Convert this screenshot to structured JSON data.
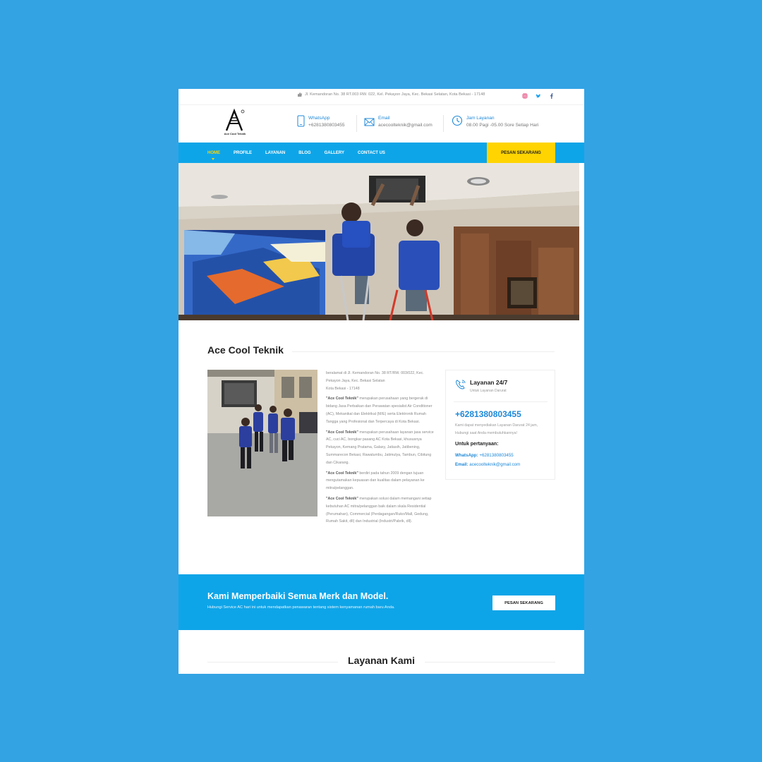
{
  "topbar": {
    "address": "Jl. Kemandoran No. 38 RT.003 RW. 022, Kel. Pekayon Jaya, Kec. Bekasi Selatan, Kota Bekasi - 17148",
    "social_icons": [
      "instagram-icon",
      "twitter-icon",
      "facebook-icon"
    ]
  },
  "header": {
    "logo_text": "Ace Cool Teknik",
    "whatsapp": {
      "label": "WhatsApp",
      "value": "+6281380803455"
    },
    "email": {
      "label": "Email",
      "value": "acecoolteknik@gmail.com"
    },
    "hours": {
      "label": "Jam Layanan",
      "value": "08.00 Pagi -05.00 Sore Setiap Hari"
    }
  },
  "nav": {
    "items": [
      "HOME",
      "PROFILE",
      "LAYANAN",
      "BLOG",
      "GALLERY",
      "CONTACT US"
    ],
    "active": "HOME",
    "cta": "PESAN SEKARANG"
  },
  "about": {
    "title": "Ace Cool Teknik",
    "address_lines": [
      "beralamat di Jl. Kemandoran No. 38 RT/RW. 003/022, Kec. Pekayon Jaya, Kec. Bekasi Selatan",
      "Kota Bekasi - 17148"
    ],
    "p1_brand": "\"Ace Cool Teknik\"",
    "p1": " merupakan perusahaan yang bergerak di bidang Jasa Perbaikan dan Perawatan spesialist Air Conditioner (AC), Mekanikal dan Elektrikal (M/E) serta Elektronik Rumah Tangga yang Profesional dan Terpercaya di Kota Bekasi.",
    "p2_brand": "\"Ace Cool Teknik\"",
    "p2": " merupakan perusahaan layanan jasa service AC, cuci AC, bongkar pasang AC Kota Bekasi, khususnya Pekayon, Kemang Pratama, Galaxy, Jatiasih, Jatibening, Summarecon Bekasi, Rawalumbu, Jatimulya, Tambun, Cibitung dan Cikarang.",
    "p3_brand": "\"Ace Cool Teknik\"",
    "p3": " berdiri pada tahun 2009 dengan tujuan mengutamakan kepuasan dan kualitas dalam pelayanan ke mitra/pelanggan.",
    "p4_brand": "\"Ace Cool Teknik\"",
    "p4": " merupakan solusi dalam memangani setiap kebutuhan AC mitra/pelanggan baik dalam skala Residential (Perumahan), Commercial (Perdagangan/Ruko/Mall, Gedung, Rumah Sakit, dll) dan Industrial (Industri/Pabrik, dll)."
  },
  "card": {
    "title": "Layanan 24/7",
    "subtitle": "Untuk Layanan Darurat",
    "phone": "+6281380803455",
    "desc": "Kami dapat menyediakan Layanan Darurat 24 jam, Hubungi saat Anda membutuhkannya!",
    "question": "Untuk pertanyaan:",
    "wa_label": "WhatsApp:",
    "wa_value": " +6281380803455",
    "email_label": "Email:",
    "email_value": " acecoolteknik@gmail.com"
  },
  "banner": {
    "title": "Kami Memperbaiki Semua Merk dan Model.",
    "subtitle": "Hubungi Service AC hari ini untuk mendapatkan penawaran tentang sistem kenyamanan rumah baru Anda.",
    "button": "PESAN SEKARANG"
  },
  "services": {
    "title": "Layanan Kami"
  },
  "colors": {
    "page_bg": "#33a3e4",
    "nav_bg": "#0ea5e8",
    "cta_yellow": "#ffd400",
    "link_blue": "#1e88d8"
  }
}
